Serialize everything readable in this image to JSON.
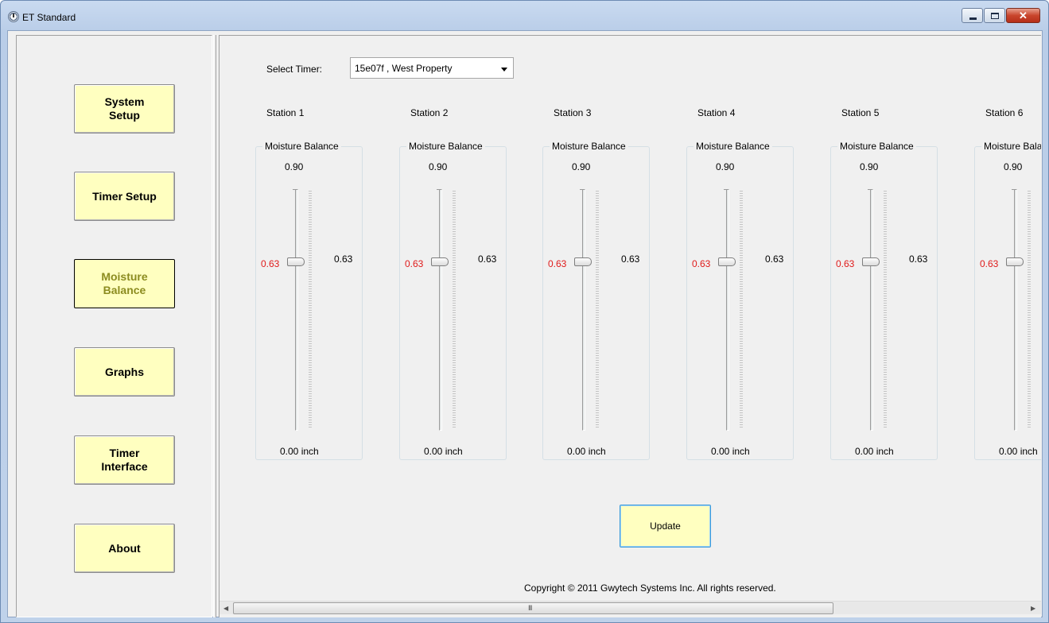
{
  "window": {
    "title": "ET Standard"
  },
  "sidebar": {
    "buttons": [
      {
        "id": "system-setup",
        "label": "System\nSetup",
        "active": false
      },
      {
        "id": "timer-setup",
        "label": "Timer Setup",
        "active": false
      },
      {
        "id": "moisture-balance",
        "label": "Moisture\nBalance",
        "active": true
      },
      {
        "id": "graphs",
        "label": "Graphs",
        "active": false
      },
      {
        "id": "timer-interface",
        "label": "Timer\nInterface",
        "active": false
      },
      {
        "id": "about",
        "label": "About",
        "active": false
      }
    ]
  },
  "main": {
    "select_label": "Select Timer:",
    "select_value": "15e07f , West Property",
    "group_title": "Moisture Balance",
    "stations": [
      {
        "label": "Station 1",
        "max": "0.90",
        "current": "0.63",
        "side": "0.63",
        "min": "0.00 inch",
        "level": 0.7
      },
      {
        "label": "Station 2",
        "max": "0.90",
        "current": "0.63",
        "side": "0.63",
        "min": "0.00 inch",
        "level": 0.7
      },
      {
        "label": "Station 3",
        "max": "0.90",
        "current": "0.63",
        "side": "0.63",
        "min": "0.00 inch",
        "level": 0.7
      },
      {
        "label": "Station 4",
        "max": "0.90",
        "current": "0.63",
        "side": "0.63",
        "min": "0.00 inch",
        "level": 0.7
      },
      {
        "label": "Station 5",
        "max": "0.90",
        "current": "0.63",
        "side": "0.63",
        "min": "0.00 inch",
        "level": 0.7
      },
      {
        "label": "Station 6",
        "max": "0.90",
        "current": "0.63",
        "side": "",
        "min": "0.00 inch",
        "level": 0.7
      }
    ],
    "update_label": "Update",
    "copyright": "Copyright © 2011 Gwytech Systems Inc. All rights reserved.",
    "scroll_grip": "III"
  }
}
